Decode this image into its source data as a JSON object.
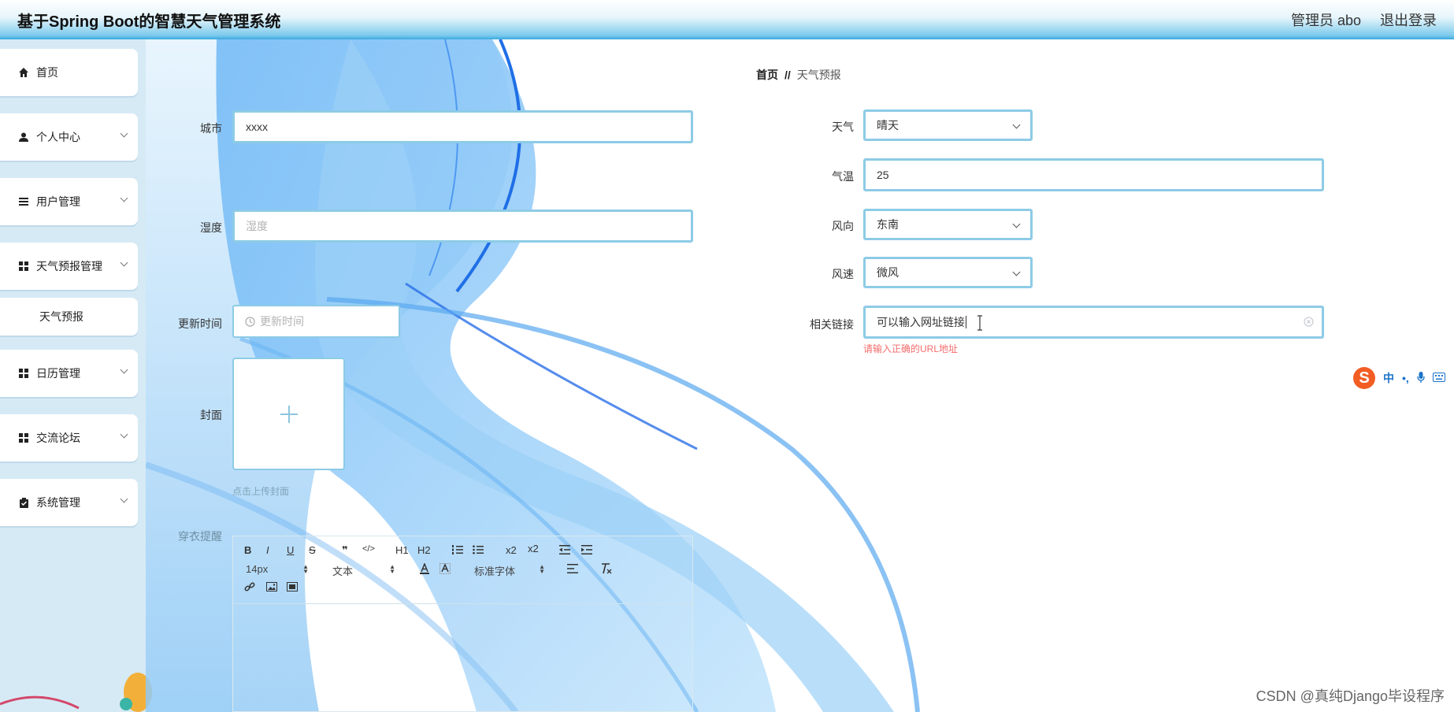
{
  "header": {
    "title": "基于Spring Boot的智慧天气管理系统",
    "user": "管理员 abo",
    "logout": "退出登录"
  },
  "sidebar": {
    "items": [
      {
        "label": "首页",
        "icon": "home-icon"
      },
      {
        "label": "个人中心",
        "icon": "user-icon"
      },
      {
        "label": "用户管理",
        "icon": "list-icon"
      },
      {
        "label": "天气预报管理",
        "icon": "grid-icon"
      },
      {
        "label": "天气预报",
        "icon": ""
      },
      {
        "label": "日历管理",
        "icon": "grid-icon"
      },
      {
        "label": "交流论坛",
        "icon": "grid-icon"
      },
      {
        "label": "系统管理",
        "icon": "clipboard-icon"
      }
    ]
  },
  "breadcrumb": {
    "home": "首页",
    "separator": "//",
    "current": "天气预报"
  },
  "form": {
    "city": {
      "label": "城市",
      "value": "xxxx"
    },
    "humidity": {
      "label": "湿度",
      "placeholder": "湿度"
    },
    "update_time": {
      "label": "更新时间",
      "placeholder": "更新时间"
    },
    "cover": {
      "label": "封面",
      "hint": "点击上传封面"
    },
    "dress_tip": {
      "label": "穿衣提醒"
    },
    "weather": {
      "label": "天气",
      "value": "晴天"
    },
    "temperature": {
      "label": "气温",
      "value": "25"
    },
    "wind_direction": {
      "label": "风向",
      "value": "东南"
    },
    "wind_speed": {
      "label": "风速",
      "value": "微风"
    },
    "link": {
      "label": "相关链接",
      "value": "可以输入网址链接",
      "error": "请输入正确的URL地址"
    }
  },
  "editor": {
    "font_size": "14px",
    "text_type": "文本",
    "font_family": "标准字体",
    "buttons": [
      "B",
      "I",
      "U",
      "S",
      "❞",
      "</>",
      "H1",
      "H2",
      "ol",
      "ul",
      "x2",
      "x2",
      "outdent",
      "indent"
    ]
  },
  "ime": {
    "logo": "S",
    "mode": "中"
  },
  "watermark": "CSDN @真纯Django毕设程序",
  "colors": {
    "input_border": "#8dcbe6",
    "error": "#f56c6c",
    "sidebar_bg": "#d6eaf5"
  }
}
